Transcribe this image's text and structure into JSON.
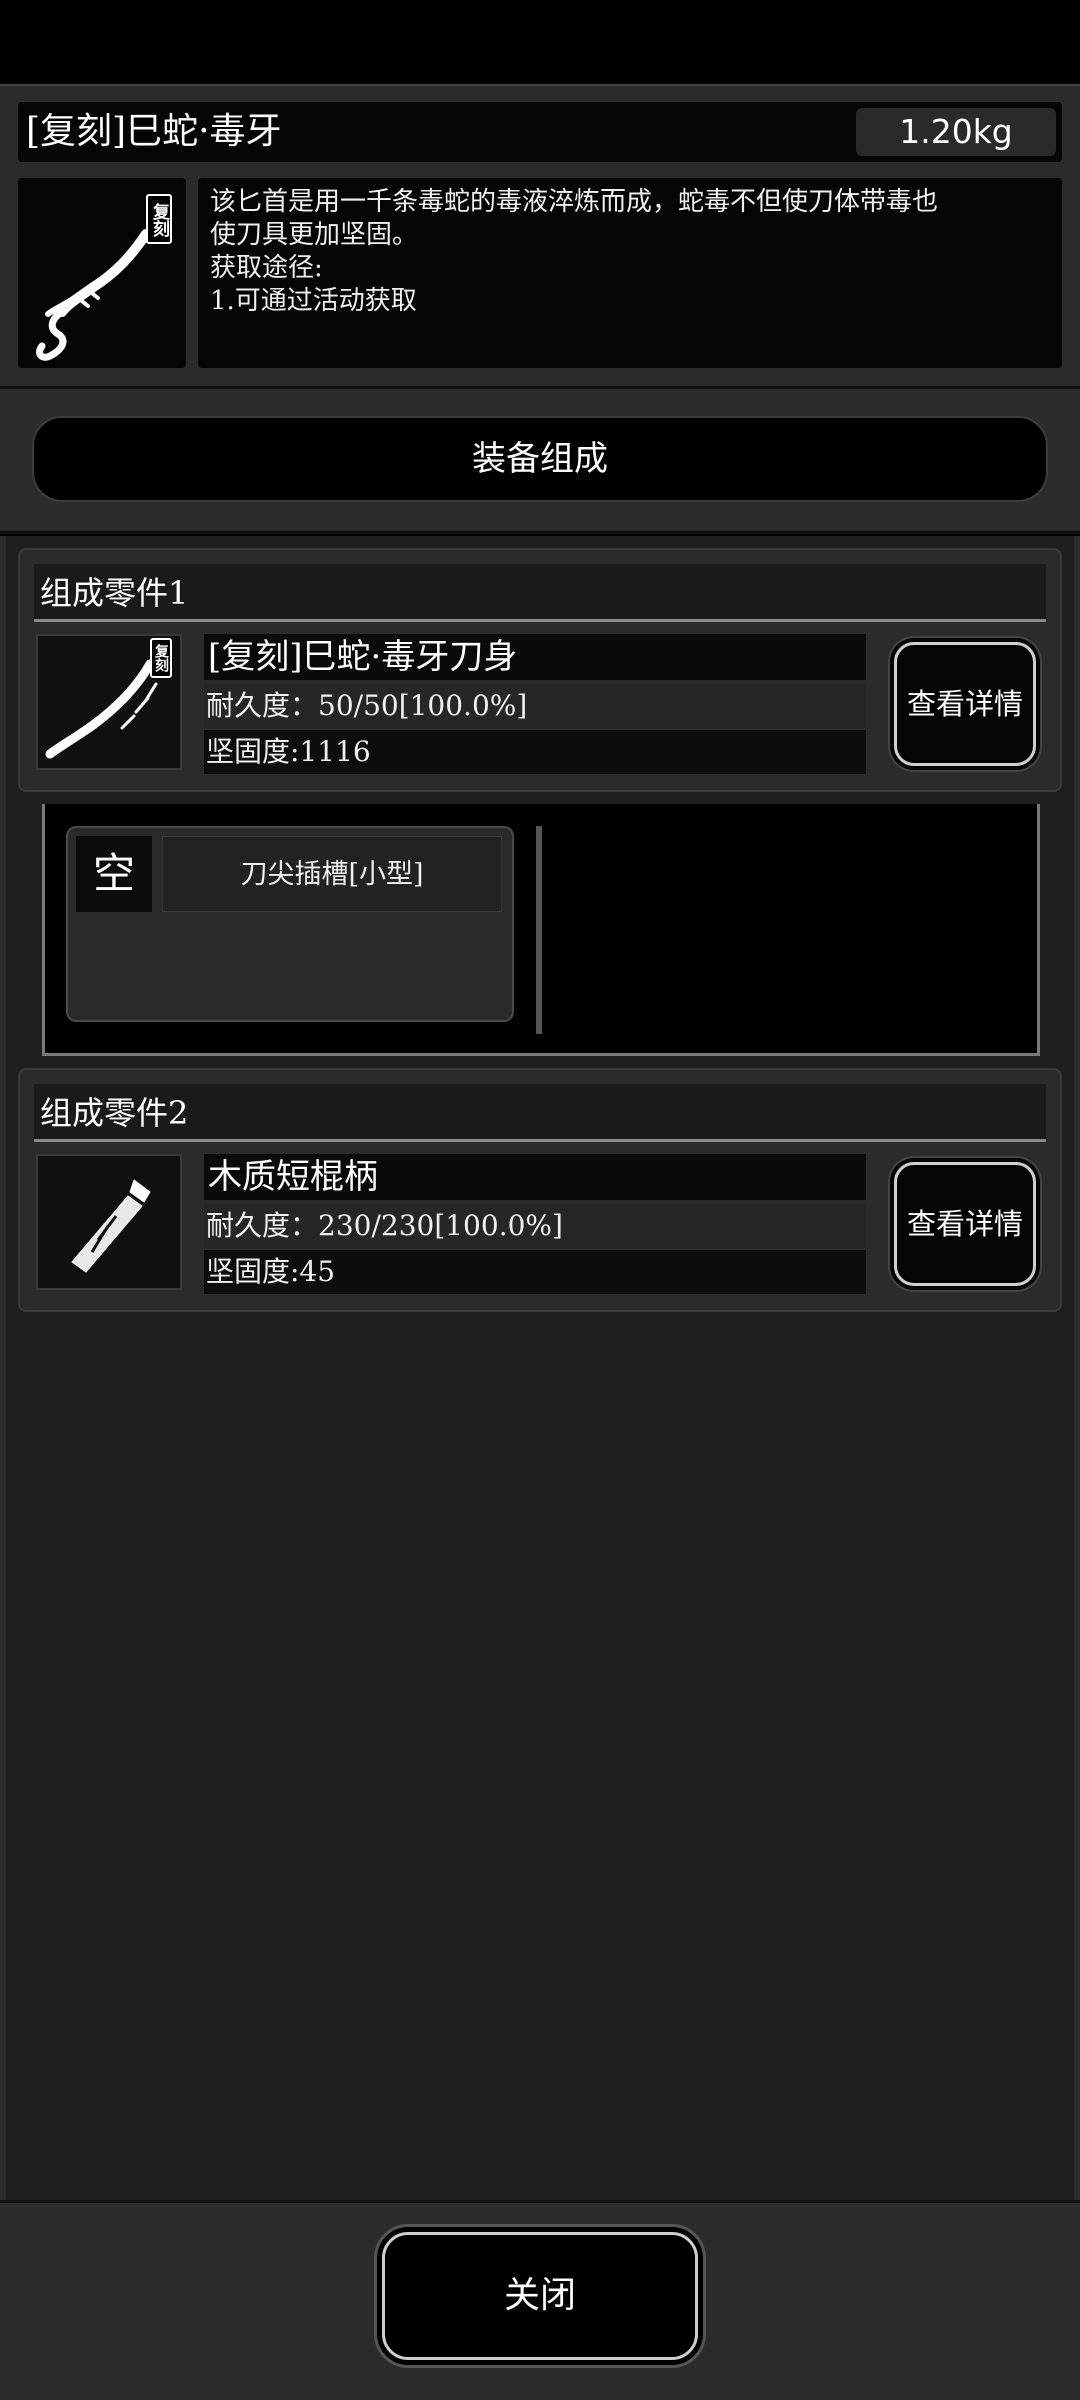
{
  "item": {
    "title": "[复刻]巳蛇·毒牙",
    "weight": "1.20kg",
    "badge": "复刻",
    "description": [
      "该匕首是用一千条毒蛇的毒液淬炼而成，蛇毒不但使刀体带毒也",
      "使刀具更加坚固。",
      "获取途径:",
      "1.可通过活动获取"
    ]
  },
  "section": {
    "title": "装备组成"
  },
  "parts": [
    {
      "header": "组成零件1",
      "name": "[复刻]巳蛇·毒牙刀身",
      "durability": "耐久度：50/50[100.0%]",
      "hardness": "坚固度:1116",
      "detail_label": "查看详情",
      "badge": "复刻",
      "slots": [
        {
          "state": "空",
          "label": "刀尖插槽[小型]"
        }
      ]
    },
    {
      "header": "组成零件2",
      "name": "木质短棍柄",
      "durability": "耐久度：230/230[100.0%]",
      "hardness": "坚固度:45",
      "detail_label": "查看详情"
    }
  ],
  "footer": {
    "close_label": "关闭"
  }
}
